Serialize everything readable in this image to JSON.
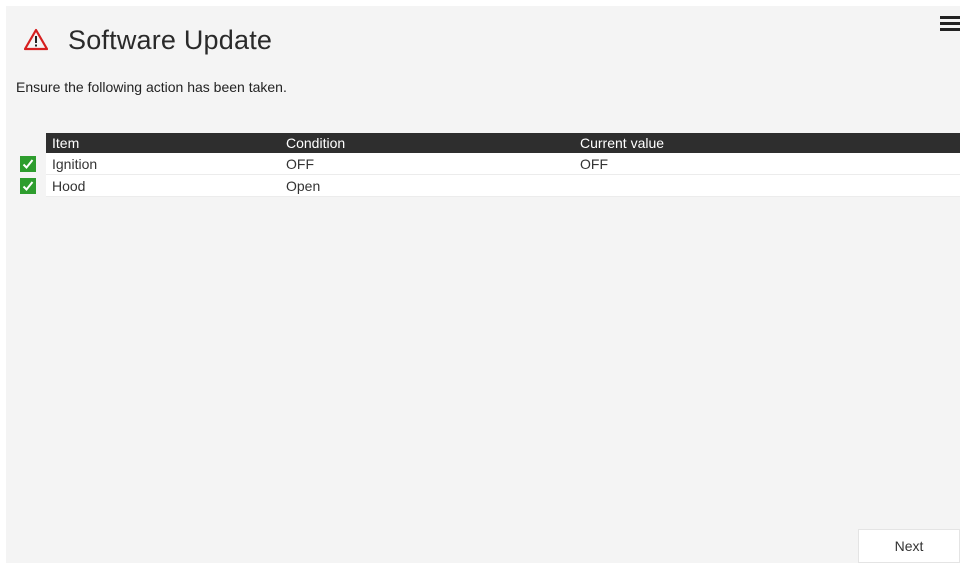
{
  "header": {
    "icon": "warning-triangle-icon",
    "title": "Software Update",
    "menu_icon": "hamburger-menu-icon"
  },
  "instruction": "Ensure the following action has been taken.",
  "table": {
    "columns": [
      "Item",
      "Condition",
      "Current value"
    ],
    "rows": [
      {
        "checked": true,
        "item": "Ignition",
        "condition": "OFF",
        "current_value": "OFF"
      },
      {
        "checked": true,
        "item": "Hood",
        "condition": "Open",
        "current_value": ""
      }
    ]
  },
  "footer": {
    "next_label": "Next"
  },
  "colors": {
    "warning": "#d62020",
    "check": "#2e9d2e",
    "header_bg": "#2e2e2e",
    "background": "#f4f4f4"
  }
}
